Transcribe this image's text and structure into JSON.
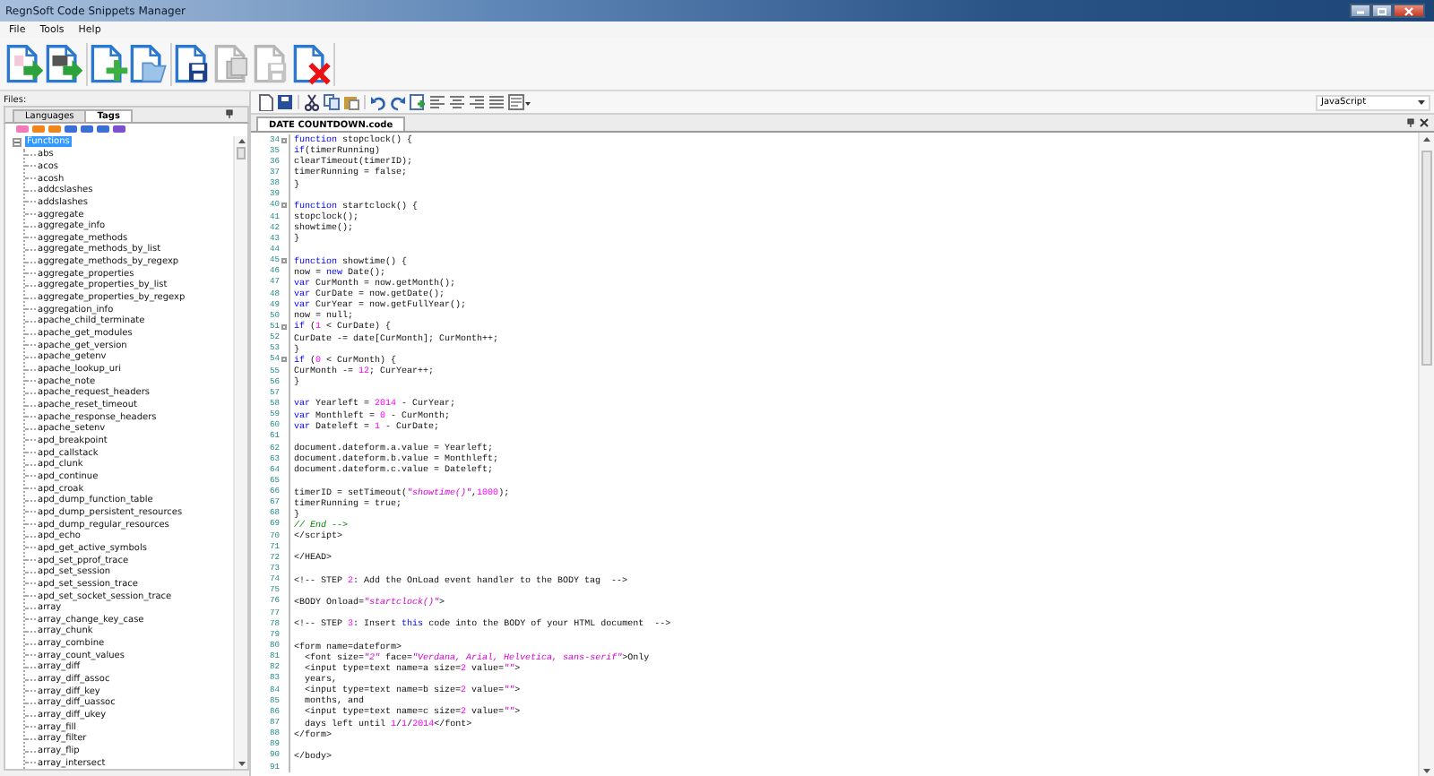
{
  "window": {
    "title": "RegnSoft Code Snippets Manager"
  },
  "menu": [
    "File",
    "Tools",
    "Help"
  ],
  "toolbar": [
    {
      "kind": "import",
      "disabled": false
    },
    {
      "kind": "export",
      "disabled": false
    },
    {
      "kind": "add",
      "disabled": false
    },
    {
      "kind": "open",
      "disabled": false
    },
    {
      "kind": "save",
      "disabled": false
    },
    {
      "kind": "copy",
      "disabled": true
    },
    {
      "kind": "save",
      "disabled": true
    },
    {
      "kind": "delete",
      "disabled": false
    }
  ],
  "files_panel": {
    "label": "Files:",
    "tabs": [
      {
        "label": "Languages",
        "selected": false
      },
      {
        "label": "Tags",
        "selected": true
      }
    ],
    "tags": [
      {
        "color": "#f27ab8"
      },
      {
        "color": "#f0851e"
      },
      {
        "color": "#f0851e"
      },
      {
        "color": "#3b6fd6"
      },
      {
        "color": "#3b6fd6"
      },
      {
        "color": "#3b6fd6"
      },
      {
        "color": "#7a4fd0"
      }
    ],
    "tree": {
      "label": "Functions",
      "expanded": true,
      "selected": true,
      "children": [
        {
          "label": "abs",
          "selected": false
        },
        {
          "label": "acos",
          "selected": false
        },
        {
          "label": "acosh",
          "selected": false
        },
        {
          "label": "addcslashes",
          "selected": false
        },
        {
          "label": "addslashes",
          "selected": false
        },
        {
          "label": "aggregate",
          "selected": false
        },
        {
          "label": "aggregate_info",
          "selected": false
        },
        {
          "label": "aggregate_methods",
          "selected": false
        },
        {
          "label": "aggregate_methods_by_list",
          "selected": false
        },
        {
          "label": "aggregate_methods_by_regexp",
          "selected": false
        },
        {
          "label": "aggregate_properties",
          "selected": false
        },
        {
          "label": "aggregate_properties_by_list",
          "selected": false
        },
        {
          "label": "aggregate_properties_by_regexp",
          "selected": false
        },
        {
          "label": "aggregation_info",
          "selected": false
        },
        {
          "label": "apache_child_terminate",
          "selected": false
        },
        {
          "label": "apache_get_modules",
          "selected": false
        },
        {
          "label": "apache_get_version",
          "selected": false
        },
        {
          "label": "apache_getenv",
          "selected": false
        },
        {
          "label": "apache_lookup_uri",
          "selected": false
        },
        {
          "label": "apache_note",
          "selected": false
        },
        {
          "label": "apache_request_headers",
          "selected": false
        },
        {
          "label": "apache_reset_timeout",
          "selected": false
        },
        {
          "label": "apache_response_headers",
          "selected": false
        },
        {
          "label": "apache_setenv",
          "selected": false
        },
        {
          "label": "apd_breakpoint",
          "selected": false
        },
        {
          "label": "apd_callstack",
          "selected": false
        },
        {
          "label": "apd_clunk",
          "selected": false
        },
        {
          "label": "apd_continue",
          "selected": false
        },
        {
          "label": "apd_croak",
          "selected": false
        },
        {
          "label": "apd_dump_function_table",
          "selected": false
        },
        {
          "label": "apd_dump_persistent_resources",
          "selected": false
        },
        {
          "label": "apd_dump_regular_resources",
          "selected": false
        },
        {
          "label": "apd_echo",
          "selected": false
        },
        {
          "label": "apd_get_active_symbols",
          "selected": false
        },
        {
          "label": "apd_set_pprof_trace",
          "selected": false
        },
        {
          "label": "apd_set_session",
          "selected": false
        },
        {
          "label": "apd_set_session_trace",
          "selected": false
        },
        {
          "label": "apd_set_socket_session_trace",
          "selected": false
        },
        {
          "label": "array",
          "selected": false
        },
        {
          "label": "array_change_key_case",
          "selected": false
        },
        {
          "label": "array_chunk",
          "selected": false
        },
        {
          "label": "array_combine",
          "selected": false
        },
        {
          "label": "array_count_values",
          "selected": false
        },
        {
          "label": "array_diff",
          "selected": false
        },
        {
          "label": "array_diff_assoc",
          "selected": false
        },
        {
          "label": "array_diff_key",
          "selected": false
        },
        {
          "label": "array_diff_uassoc",
          "selected": false
        },
        {
          "label": "array_diff_ukey",
          "selected": false
        },
        {
          "label": "array_fill",
          "selected": false
        },
        {
          "label": "array_filter",
          "selected": false
        },
        {
          "label": "array_flip",
          "selected": false
        },
        {
          "label": "array_intersect",
          "selected": false
        }
      ]
    }
  },
  "editor": {
    "language": "JavaScript",
    "tabs": [
      {
        "label": "DATE COUNTDOWN.code",
        "selected": true
      }
    ],
    "lines": [
      {
        "n": "34",
        "fold": true,
        "tokens": [
          {
            "kind": "keyword",
            "text": "function"
          },
          {
            "kind": "plain",
            "text": " stopclock() {"
          }
        ]
      },
      {
        "n": "35",
        "fold": false,
        "tokens": [
          {
            "kind": "keyword",
            "text": "if"
          },
          {
            "kind": "plain",
            "text": "(timerRunning)"
          }
        ]
      },
      {
        "n": "36",
        "fold": false,
        "tokens": [
          {
            "kind": "plain",
            "text": "clearTimeout(timerID);"
          }
        ]
      },
      {
        "n": "37",
        "fold": false,
        "tokens": [
          {
            "kind": "plain",
            "text": "timerRunning = false;"
          }
        ]
      },
      {
        "n": "38",
        "fold": false,
        "tokens": [
          {
            "kind": "plain",
            "text": "}"
          }
        ]
      },
      {
        "n": "39",
        "fold": false
      },
      {
        "n": "40",
        "fold": true,
        "tokens": [
          {
            "kind": "keyword",
            "text": "function"
          },
          {
            "kind": "plain",
            "text": " startclock() {"
          }
        ]
      },
      {
        "n": "41",
        "fold": false,
        "tokens": [
          {
            "kind": "plain",
            "text": "stopclock();"
          }
        ]
      },
      {
        "n": "42",
        "fold": false,
        "tokens": [
          {
            "kind": "plain",
            "text": "showtime();"
          }
        ]
      },
      {
        "n": "43",
        "fold": false,
        "tokens": [
          {
            "kind": "plain",
            "text": "}"
          }
        ]
      },
      {
        "n": "44",
        "fold": false
      },
      {
        "n": "45",
        "fold": true,
        "tokens": [
          {
            "kind": "keyword",
            "text": "function"
          },
          {
            "kind": "plain",
            "text": " showtime() {"
          }
        ]
      },
      {
        "n": "46",
        "fold": false,
        "tokens": [
          {
            "kind": "plain",
            "text": "now = "
          },
          {
            "kind": "keyword",
            "text": "new"
          },
          {
            "kind": "plain",
            "text": " Date();"
          }
        ]
      },
      {
        "n": "47",
        "fold": false,
        "tokens": [
          {
            "kind": "keyword",
            "text": "var"
          },
          {
            "kind": "plain",
            "text": " CurMonth = now.getMonth();"
          }
        ]
      },
      {
        "n": "48",
        "fold": false,
        "tokens": [
          {
            "kind": "keyword",
            "text": "var"
          },
          {
            "kind": "plain",
            "text": " CurDate = now.getDate();"
          }
        ]
      },
      {
        "n": "49",
        "fold": false,
        "tokens": [
          {
            "kind": "keyword",
            "text": "var"
          },
          {
            "kind": "plain",
            "text": " CurYear = now.getFullYear();"
          }
        ]
      },
      {
        "n": "50",
        "fold": false,
        "tokens": [
          {
            "kind": "plain",
            "text": "now = null;"
          }
        ]
      },
      {
        "n": "51",
        "fold": true,
        "tokens": [
          {
            "kind": "keyword",
            "text": "if"
          },
          {
            "kind": "plain",
            "text": " ("
          },
          {
            "kind": "number",
            "text": "1"
          },
          {
            "kind": "plain",
            "text": " < CurDate) {"
          }
        ]
      },
      {
        "n": "52",
        "fold": false,
        "tokens": [
          {
            "kind": "plain",
            "text": "CurDate -= date[CurMonth]; CurMonth++;"
          }
        ]
      },
      {
        "n": "53",
        "fold": false,
        "tokens": [
          {
            "kind": "plain",
            "text": "}"
          }
        ]
      },
      {
        "n": "54",
        "fold": true,
        "tokens": [
          {
            "kind": "keyword",
            "text": "if"
          },
          {
            "kind": "plain",
            "text": " ("
          },
          {
            "kind": "number",
            "text": "0"
          },
          {
            "kind": "plain",
            "text": " < CurMonth) {"
          }
        ]
      },
      {
        "n": "55",
        "fold": false,
        "tokens": [
          {
            "kind": "plain",
            "text": "CurMonth -= "
          },
          {
            "kind": "number",
            "text": "12"
          },
          {
            "kind": "plain",
            "text": "; CurYear++;"
          }
        ]
      },
      {
        "n": "56",
        "fold": false,
        "tokens": [
          {
            "kind": "plain",
            "text": "}"
          }
        ]
      },
      {
        "n": "57",
        "fold": false
      },
      {
        "n": "58",
        "fold": false,
        "tokens": [
          {
            "kind": "keyword",
            "text": "var"
          },
          {
            "kind": "plain",
            "text": " Yearleft = "
          },
          {
            "kind": "number",
            "text": "2014"
          },
          {
            "kind": "plain",
            "text": " - CurYear;"
          }
        ]
      },
      {
        "n": "59",
        "fold": false,
        "tokens": [
          {
            "kind": "keyword",
            "text": "var"
          },
          {
            "kind": "plain",
            "text": " Monthleft = "
          },
          {
            "kind": "number",
            "text": "0"
          },
          {
            "kind": "plain",
            "text": " - CurMonth;"
          }
        ]
      },
      {
        "n": "60",
        "fold": false,
        "tokens": [
          {
            "kind": "keyword",
            "text": "var"
          },
          {
            "kind": "plain",
            "text": " Dateleft = "
          },
          {
            "kind": "number",
            "text": "1"
          },
          {
            "kind": "plain",
            "text": " - CurDate;"
          }
        ]
      },
      {
        "n": "61",
        "fold": false
      },
      {
        "n": "62",
        "fold": false,
        "tokens": [
          {
            "kind": "plain",
            "text": "document.dateform.a.value = Yearleft;"
          }
        ]
      },
      {
        "n": "63",
        "fold": false,
        "tokens": [
          {
            "kind": "plain",
            "text": "document.dateform.b.value = Monthleft;"
          }
        ]
      },
      {
        "n": "64",
        "fold": false,
        "tokens": [
          {
            "kind": "plain",
            "text": "document.dateform.c.value = Dateleft;"
          }
        ]
      },
      {
        "n": "65",
        "fold": false
      },
      {
        "n": "66",
        "fold": false,
        "tokens": [
          {
            "kind": "plain",
            "text": "timerID = setTimeout("
          },
          {
            "kind": "string",
            "text": "\"showtime()\""
          },
          {
            "kind": "plain",
            "text": ","
          },
          {
            "kind": "number",
            "text": "1000"
          },
          {
            "kind": "plain",
            "text": ");"
          }
        ]
      },
      {
        "n": "67",
        "fold": false,
        "tokens": [
          {
            "kind": "plain",
            "text": "timerRunning = true;"
          }
        ]
      },
      {
        "n": "68",
        "fold": false,
        "tokens": [
          {
            "kind": "plain",
            "text": "}"
          }
        ]
      },
      {
        "n": "69",
        "fold": false,
        "tokens": [
          {
            "kind": "comment",
            "text": "// End -->"
          }
        ]
      },
      {
        "n": "70",
        "fold": false,
        "tokens": [
          {
            "kind": "plain",
            "text": "</script>"
          }
        ]
      },
      {
        "n": "71",
        "fold": false
      },
      {
        "n": "72",
        "fold": false,
        "tokens": [
          {
            "kind": "plain",
            "text": "</HEAD>"
          }
        ]
      },
      {
        "n": "73",
        "fold": false
      },
      {
        "n": "74",
        "fold": false,
        "tokens": [
          {
            "kind": "plain",
            "text": "<!-- STEP "
          },
          {
            "kind": "number",
            "text": "2"
          },
          {
            "kind": "plain",
            "text": ": Add the OnLoad event handler to the BODY tag  -->"
          }
        ]
      },
      {
        "n": "75",
        "fold": false
      },
      {
        "n": "76",
        "fold": false,
        "tokens": [
          {
            "kind": "plain",
            "text": "<BODY Onload="
          },
          {
            "kind": "string",
            "text": "\"startclock()\""
          },
          {
            "kind": "plain",
            "text": ">"
          }
        ]
      },
      {
        "n": "77",
        "fold": false
      },
      {
        "n": "78",
        "fold": false,
        "tokens": [
          {
            "kind": "plain",
            "text": "<!-- STEP "
          },
          {
            "kind": "number",
            "text": "3"
          },
          {
            "kind": "plain",
            "text": ": Insert "
          },
          {
            "kind": "keyword",
            "text": "this"
          },
          {
            "kind": "plain",
            "text": " code into the BODY of your HTML document  -->"
          }
        ]
      },
      {
        "n": "79",
        "fold": false
      },
      {
        "n": "80",
        "fold": false,
        "tokens": [
          {
            "kind": "plain",
            "text": "<form name=dateform>"
          }
        ]
      },
      {
        "n": "81",
        "fold": false,
        "tokens": [
          {
            "kind": "plain",
            "text": "  <font size="
          },
          {
            "kind": "string",
            "text": "\"2\""
          },
          {
            "kind": "plain",
            "text": " face="
          },
          {
            "kind": "string",
            "text": "\"Verdana, Arial, Helvetica, sans-serif\""
          },
          {
            "kind": "plain",
            "text": ">Only"
          }
        ]
      },
      {
        "n": "82",
        "fold": false,
        "tokens": [
          {
            "kind": "plain",
            "text": "  <input type=text name=a size="
          },
          {
            "kind": "number",
            "text": "2"
          },
          {
            "kind": "plain",
            "text": " value="
          },
          {
            "kind": "string",
            "text": "\"\""
          },
          {
            "kind": "plain",
            "text": ">"
          }
        ]
      },
      {
        "n": "83",
        "fold": false,
        "tokens": [
          {
            "kind": "plain",
            "text": "  years,"
          }
        ]
      },
      {
        "n": "84",
        "fold": false,
        "tokens": [
          {
            "kind": "plain",
            "text": "  <input type=text name=b size="
          },
          {
            "kind": "number",
            "text": "2"
          },
          {
            "kind": "plain",
            "text": " value="
          },
          {
            "kind": "string",
            "text": "\"\""
          },
          {
            "kind": "plain",
            "text": ">"
          }
        ]
      },
      {
        "n": "85",
        "fold": false,
        "tokens": [
          {
            "kind": "plain",
            "text": "  months, and"
          }
        ]
      },
      {
        "n": "86",
        "fold": false,
        "tokens": [
          {
            "kind": "plain",
            "text": "  <input type=text name=c size="
          },
          {
            "kind": "number",
            "text": "2"
          },
          {
            "kind": "plain",
            "text": " value="
          },
          {
            "kind": "string",
            "text": "\"\""
          },
          {
            "kind": "plain",
            "text": ">"
          }
        ]
      },
      {
        "n": "87",
        "fold": false,
        "tokens": [
          {
            "kind": "plain",
            "text": "  days left until "
          },
          {
            "kind": "number",
            "text": "1"
          },
          {
            "kind": "plain",
            "text": "/"
          },
          {
            "kind": "number",
            "text": "1"
          },
          {
            "kind": "plain",
            "text": "/"
          },
          {
            "kind": "number",
            "text": "2014"
          },
          {
            "kind": "plain",
            "text": "</font>"
          }
        ]
      },
      {
        "n": "88",
        "fold": false,
        "tokens": [
          {
            "kind": "plain",
            "text": "</form>"
          }
        ]
      },
      {
        "n": "89",
        "fold": false
      },
      {
        "n": "90",
        "fold": false,
        "tokens": [
          {
            "kind": "plain",
            "text": "</body>"
          }
        ]
      },
      {
        "n": "91",
        "fold": false
      }
    ]
  }
}
